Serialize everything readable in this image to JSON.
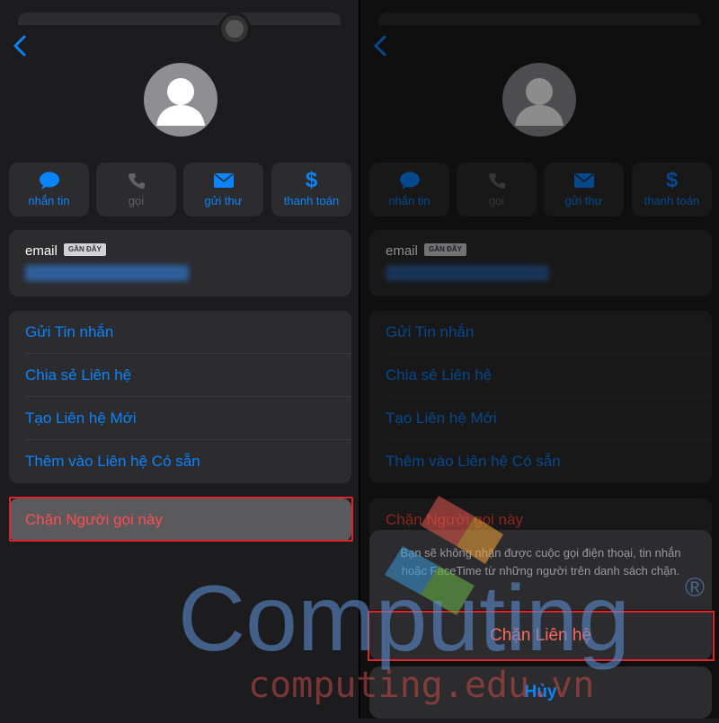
{
  "contact": {
    "back_icon": "chevron-left-icon",
    "avatar_icon": "person-icon",
    "actions": [
      {
        "label": "nhắn tin",
        "icon": "message-bubble-icon",
        "enabled": true
      },
      {
        "label": "gọi",
        "icon": "phone-icon",
        "enabled": false
      },
      {
        "label": "gửi thư",
        "icon": "envelope-icon",
        "enabled": true
      },
      {
        "label": "thanh toán",
        "icon": "dollar-icon",
        "enabled": true
      }
    ],
    "email_label": "email",
    "email_badge": "GẦN ĐÂY",
    "menu": [
      "Gửi Tin nhắn",
      "Chia sẻ Liên hệ",
      "Tạo Liên hệ Mới",
      "Thêm vào Liên hệ Có sẵn"
    ],
    "block_label": "Chặn Người gọi này"
  },
  "alert": {
    "message": "Bạn sẽ không nhận được cuộc gọi điện thoại, tin nhắn hoặc FaceTime từ những người trên danh sách chặn.",
    "confirm_label": "Chặn Liên hệ",
    "cancel_label": "Hủy"
  },
  "watermark": {
    "brand": "Computing",
    "site": "computing.edu.vn",
    "registered": "®"
  },
  "colors": {
    "accent": "#0a84ff",
    "destructive": "#ff453a",
    "highlight": "#e0242b",
    "background": "#1c1c1e",
    "card": "#2c2c2e"
  }
}
